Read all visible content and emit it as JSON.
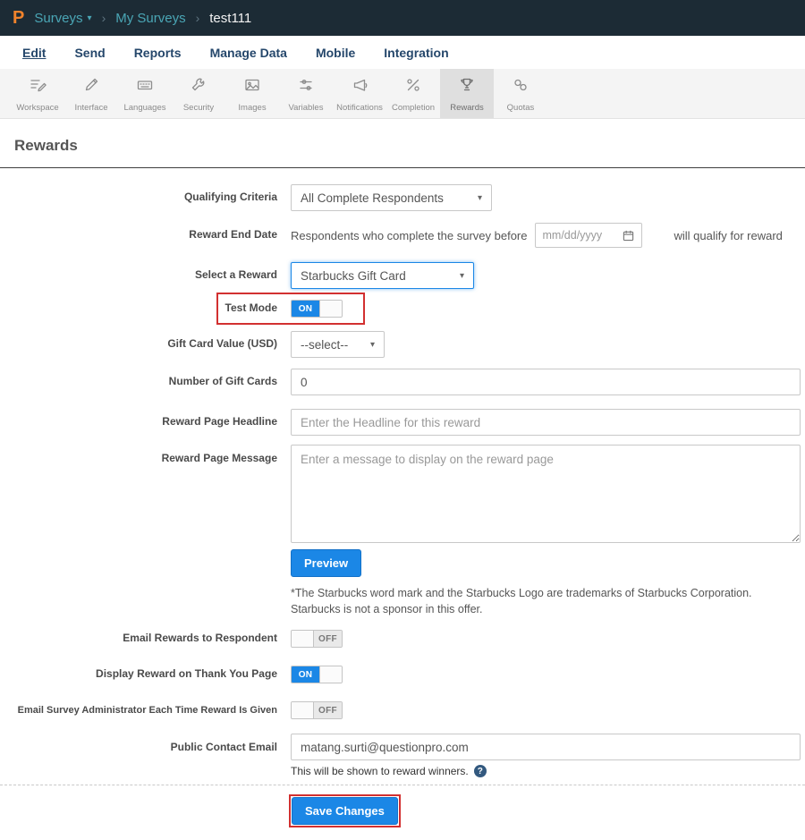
{
  "topbar": {
    "logo_text": "P",
    "breadcrumb": {
      "surveys": "Surveys",
      "my_surveys": "My Surveys",
      "survey_name": "test111"
    }
  },
  "menu": {
    "items": [
      {
        "label": "Edit",
        "active": true
      },
      {
        "label": "Send"
      },
      {
        "label": "Reports"
      },
      {
        "label": "Manage Data"
      },
      {
        "label": "Mobile"
      },
      {
        "label": "Integration"
      }
    ]
  },
  "toolbar": {
    "items": [
      {
        "label": "Workspace"
      },
      {
        "label": "Interface"
      },
      {
        "label": "Languages"
      },
      {
        "label": "Security"
      },
      {
        "label": "Images"
      },
      {
        "label": "Variables"
      },
      {
        "label": "Notifications"
      },
      {
        "label": "Completion"
      },
      {
        "label": "Rewards",
        "active": true
      },
      {
        "label": "Quotas"
      }
    ]
  },
  "page": {
    "title": "Rewards"
  },
  "form": {
    "qualifying_criteria": {
      "label": "Qualifying Criteria",
      "value": "All Complete Respondents"
    },
    "reward_end_date": {
      "label": "Reward End Date",
      "prefix": "Respondents who complete the survey before",
      "placeholder": "mm/dd/yyyy",
      "suffix": "will qualify for reward"
    },
    "select_reward": {
      "label": "Select a Reward",
      "value": "Starbucks Gift Card"
    },
    "test_mode": {
      "label": "Test Mode",
      "state": "ON"
    },
    "gift_card_value": {
      "label": "Gift Card Value (USD)",
      "value": "--select--"
    },
    "number_of_gift_cards": {
      "label": "Number of Gift Cards",
      "value": "0"
    },
    "reward_page_headline": {
      "label": "Reward Page Headline",
      "placeholder": "Enter the Headline for this reward"
    },
    "reward_page_message": {
      "label": "Reward Page Message",
      "placeholder": "Enter a message to display on the reward page"
    },
    "preview_button_label": "Preview",
    "disclaimer": "*The Starbucks word mark and the Starbucks Logo are trademarks of Starbucks Corporation. Starbucks is not a sponsor in this offer.",
    "email_rewards_to_respondent": {
      "label": "Email Rewards to Respondent",
      "state": "OFF"
    },
    "display_reward_on_thank_you": {
      "label": "Display Reward on Thank You Page",
      "state": "ON"
    },
    "email_admin_each_reward": {
      "label": "Email Survey Administrator Each Time Reward Is Given",
      "state": "OFF"
    },
    "public_contact_email": {
      "label": "Public Contact Email",
      "value": "matang.surti@questionpro.com",
      "help_text": "This will be shown to reward winners."
    },
    "save_button_label": "Save Changes"
  },
  "icons": {
    "caret_down": "▾",
    "chevron_separator": "›",
    "select_arrow": "▾",
    "help_glyph": "?"
  },
  "colors": {
    "accent_blue": "#1b87e6",
    "topbar_bg": "#1c2b35",
    "breadcrumb_teal": "#4aa6b5",
    "annotation_red": "#d23030",
    "logo_orange": "#f0832c"
  }
}
